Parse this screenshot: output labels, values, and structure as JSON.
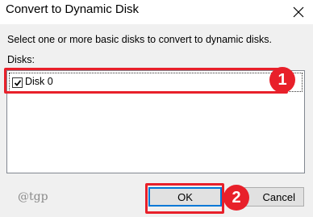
{
  "window": {
    "title": "Convert to Dynamic Disk",
    "close_icon": "close-icon"
  },
  "dialog": {
    "instruction": "Select one or more basic disks to convert to dynamic disks.",
    "disks_label": "Disks:",
    "disks": [
      {
        "label": "Disk 0",
        "checked": true
      }
    ]
  },
  "buttons": {
    "ok_label": "OK",
    "cancel_label": "Cancel"
  },
  "annotations": {
    "step1": "1",
    "step2": "2",
    "highlight_color": "#e8202a"
  },
  "watermark": "@tgp"
}
